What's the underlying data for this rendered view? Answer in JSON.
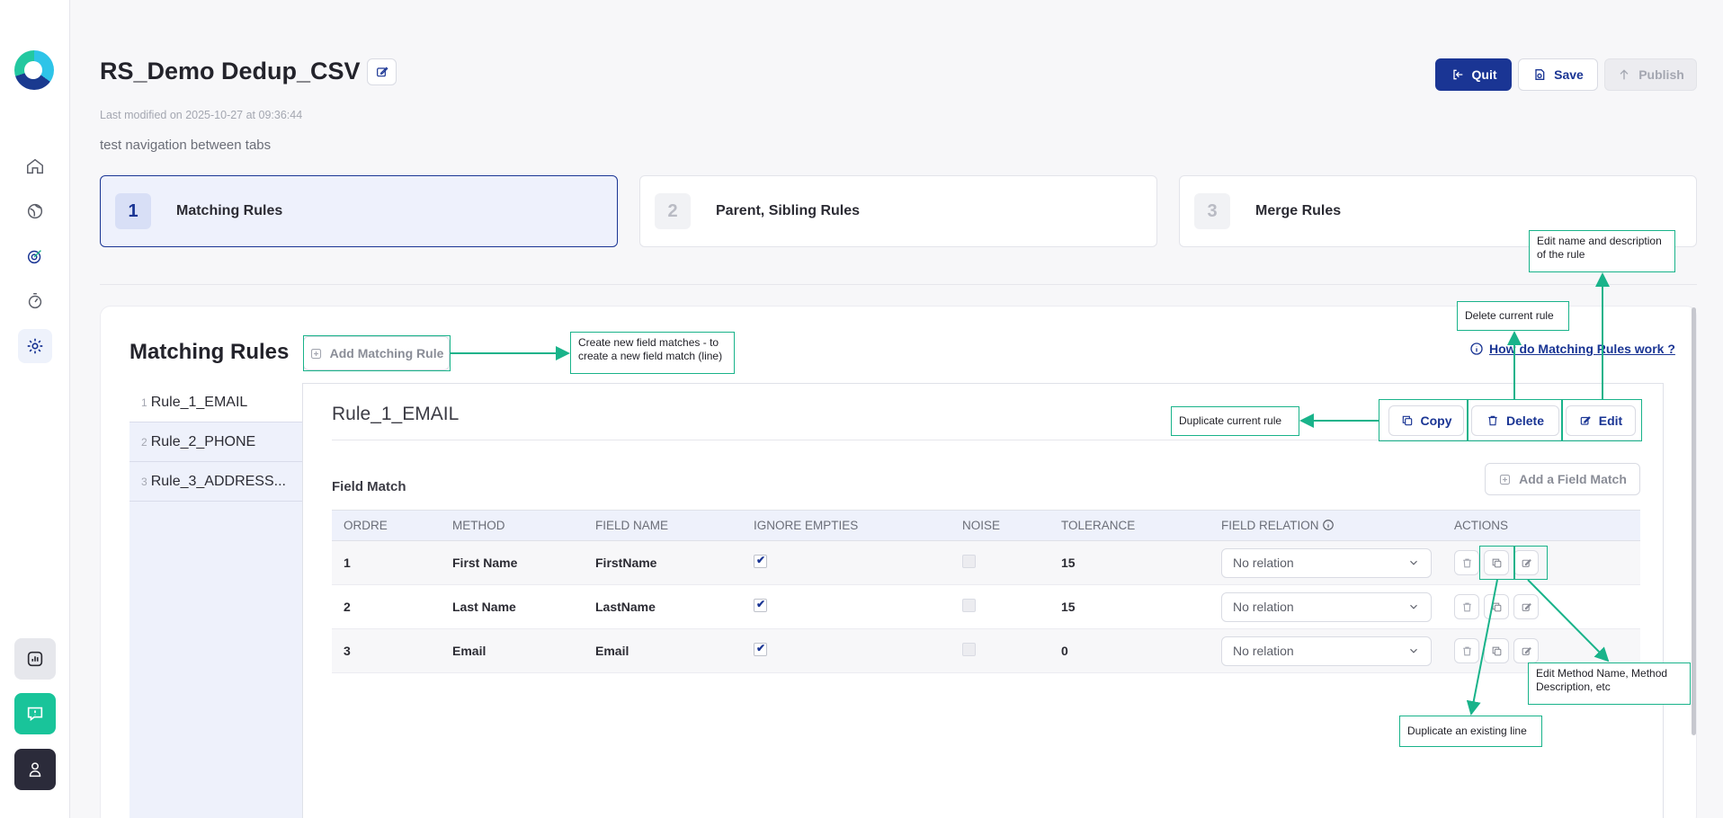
{
  "header": {
    "title": "RS_Demo Dedup_CSV",
    "last_modified": "Last modified on 2025-10-27 at 09:36:44",
    "description": "test navigation between tabs",
    "quit_label": "Quit",
    "save_label": "Save",
    "publish_label": "Publish"
  },
  "steps": [
    {
      "num": "1",
      "label": "Matching Rules",
      "active": true
    },
    {
      "num": "2",
      "label": "Parent, Sibling Rules",
      "active": false
    },
    {
      "num": "3",
      "label": "Merge Rules",
      "active": false
    }
  ],
  "matching": {
    "title": "Matching Rules",
    "add_rule_label": "Add Matching Rule",
    "help_link": "How do Matching Rules work ?",
    "rules": [
      {
        "num": "1",
        "name": "Rule_1_EMAIL"
      },
      {
        "num": "2",
        "name": "Rule_2_PHONE"
      },
      {
        "num": "3",
        "name": "Rule_3_ADDRESS..."
      }
    ],
    "current_rule": "Rule_1_EMAIL",
    "copy_label": "Copy",
    "delete_label": "Delete",
    "edit_label": "Edit",
    "field_match_title": "Field Match",
    "add_field_match_label": "Add a Field Match"
  },
  "table": {
    "headers": [
      "ORDRE",
      "METHOD",
      "FIELD NAME",
      "IGNORE EMPTIES",
      "NOISE",
      "TOLERANCE",
      "FIELD RELATION",
      "ACTIONS"
    ],
    "rows": [
      {
        "ordre": "1",
        "method": "First Name",
        "field": "FirstName",
        "ignore": true,
        "noise": false,
        "tolerance": "15",
        "relation": "No relation"
      },
      {
        "ordre": "2",
        "method": "Last Name",
        "field": "LastName",
        "ignore": true,
        "noise": false,
        "tolerance": "15",
        "relation": "No relation"
      },
      {
        "ordre": "3",
        "method": "Email",
        "field": "Email",
        "ignore": true,
        "noise": false,
        "tolerance": "0",
        "relation": "No relation"
      }
    ]
  },
  "annotations": {
    "add_rule": "Create new field matches - to create a new field match (line)",
    "duplicate_rule": "Duplicate current rule",
    "delete_rule": "Delete current rule",
    "edit_rule": "Edit name and description of the rule",
    "edit_method": "Edit Method Name, Method Description, etc",
    "duplicate_line": "Duplicate an existing line"
  },
  "colors": {
    "primary": "#1a3594",
    "annotation": "#19b38a",
    "help_button": "#19c49a"
  }
}
